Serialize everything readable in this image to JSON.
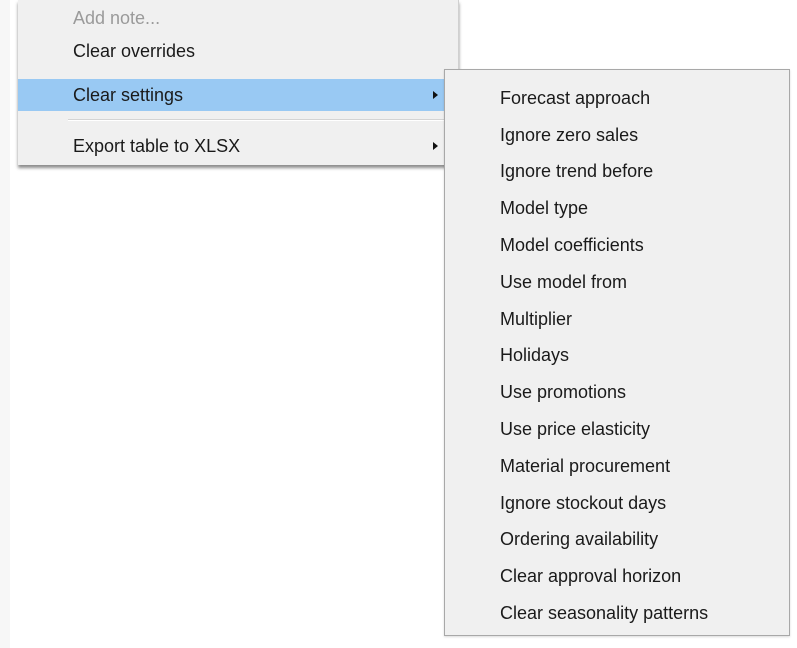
{
  "context_menu": {
    "items": [
      {
        "label": "Add note...",
        "enabled": false,
        "highlighted": false,
        "has_submenu": false
      },
      {
        "label": "Clear overrides",
        "enabled": true,
        "highlighted": false,
        "has_submenu": false
      },
      {
        "label": "Clear settings",
        "enabled": true,
        "highlighted": true,
        "has_submenu": true
      },
      {
        "label": "Export table to XLSX",
        "enabled": true,
        "highlighted": false,
        "has_submenu": true
      }
    ]
  },
  "submenu": {
    "parent": "Clear settings",
    "items": [
      "Forecast approach",
      "Ignore zero sales",
      "Ignore trend before",
      "Model type",
      "Model coefficients",
      "Use model from",
      "Multiplier",
      "Holidays",
      "Use promotions",
      "Use price elasticity",
      "Material procurement",
      "Ignore stockout days",
      "Ordering availability",
      "Clear approval horizon",
      "Clear seasonality patterns"
    ]
  },
  "colors": {
    "menu_background": "#f0f0f0",
    "highlight": "#99c9f3",
    "disabled_text": "#9a9a9a"
  }
}
